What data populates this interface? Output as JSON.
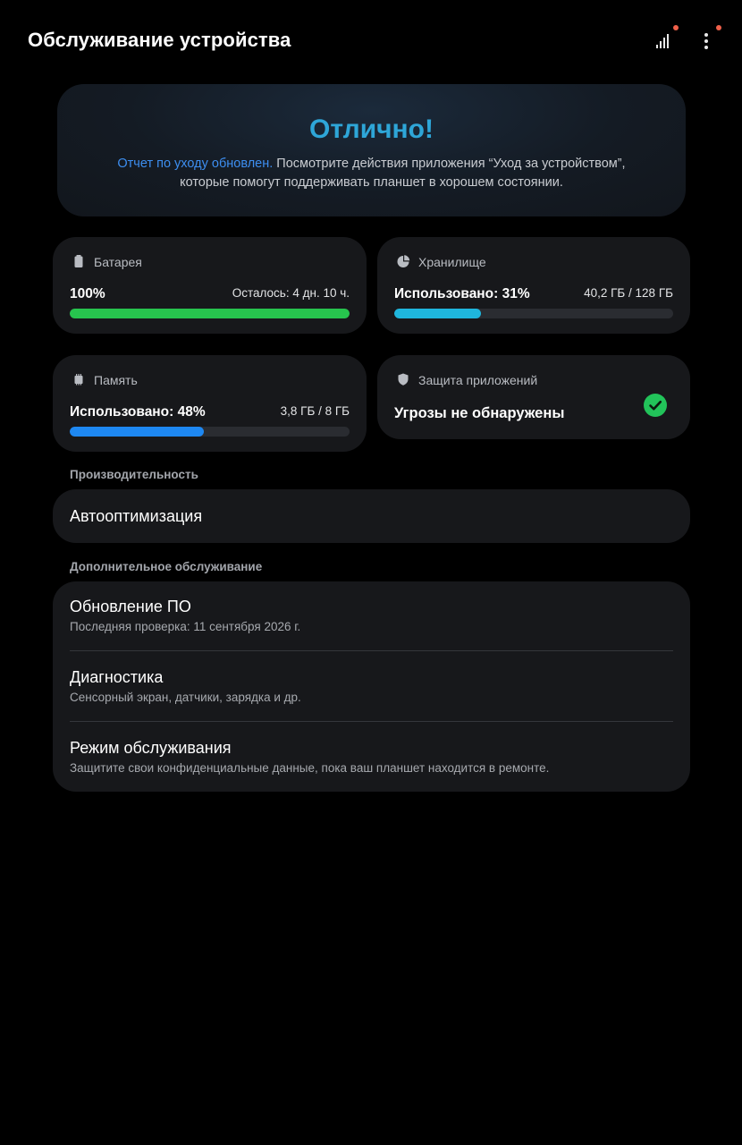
{
  "header": {
    "title": "Обслуживание устройства",
    "icons": [
      "stats-icon",
      "more-vert-icon"
    ],
    "badge_color": "#f0604a"
  },
  "hero": {
    "title": "Отлично!",
    "link_text": "Отчет по уходу обновлен.",
    "text_line1_rest": " Посмотрите действия приложения “Уход за устройством”,",
    "text_line2": "которые помогут поддерживать планшет в хорошем состоянии.",
    "title_color": "#2ea6d8",
    "link_color": "#3d8ef0"
  },
  "battery": {
    "label": "Батарея",
    "value": "100%",
    "remaining": "Осталось: 4 дн. 10 ч.",
    "level_percent": 100,
    "color": "#27c44e"
  },
  "storage": {
    "label": "Хранилище",
    "used": "Использовано: 31%",
    "amount": "40,2 ГБ / 128 ГБ",
    "level_percent": 31,
    "color": "#1fb6dd"
  },
  "memory": {
    "label": "Память",
    "used": "Использовано: 48%",
    "amount": "3,8 ГБ / 8 ГБ",
    "level_percent": 48,
    "color": "#1e88f2"
  },
  "protection": {
    "label": "Защита приложений",
    "status": "Угрозы не обнаружены",
    "check_color": "#22c35a"
  },
  "performance": {
    "header": "Производительность",
    "item": "Автооптимизация"
  },
  "extra": {
    "header": "Дополнительное обслуживание",
    "items": [
      {
        "title": "Обновление ПО",
        "subtitle": "Последняя проверка: 11 сентября 2026 г."
      },
      {
        "title": "Диагностика",
        "subtitle": "Сенсорный экран, датчики, зарядка и др."
      },
      {
        "title": "Режим обслуживания",
        "subtitle": "Защитите свои конфиденциальные данные, пока ваш планшет находится в ремонте."
      }
    ]
  }
}
